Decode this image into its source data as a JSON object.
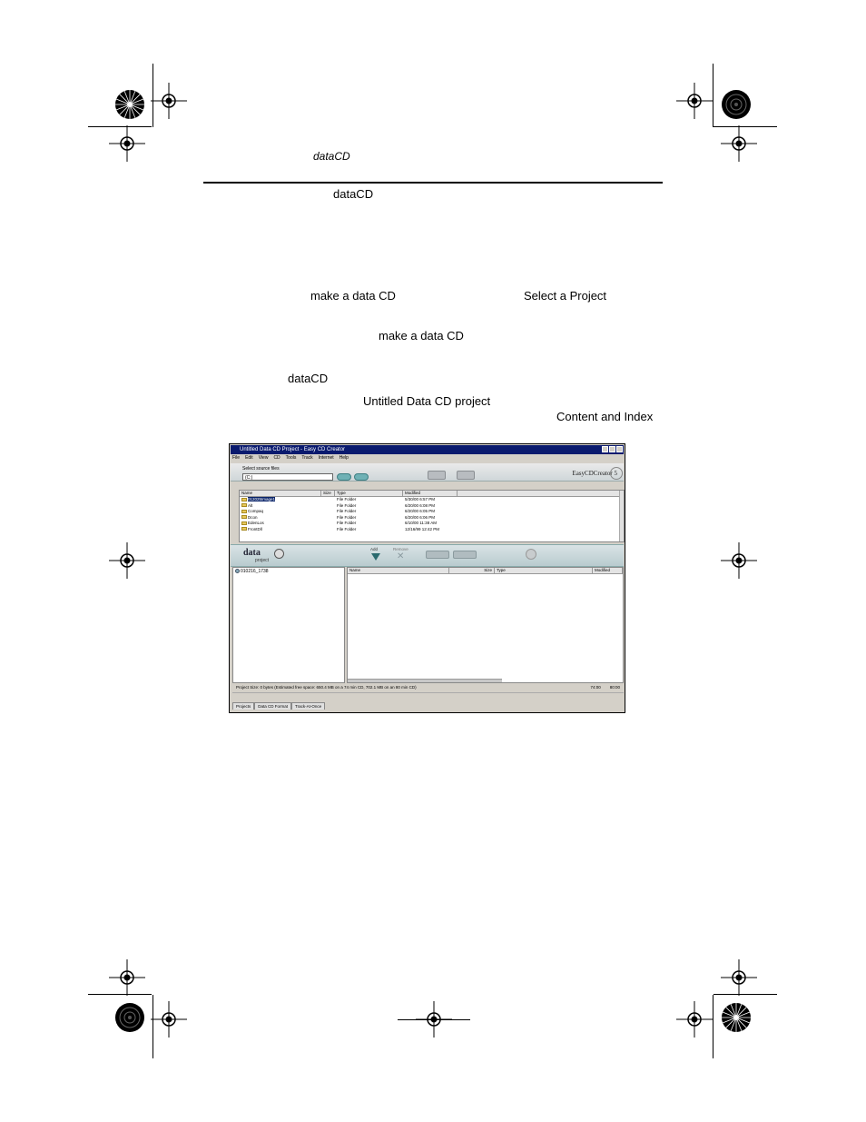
{
  "page": {
    "running_header": "dataCD",
    "body_text": {
      "t1": "dataCD",
      "t2": "make a data CD",
      "t3": "Select a Project",
      "t4": "make a data CD",
      "t5": "dataCD",
      "t6": "Untitled Data CD project",
      "t7": "Content and Index"
    }
  },
  "window": {
    "title": "Untitled Data CD Project - Easy CD Creator",
    "menu": [
      "File",
      "Edit",
      "View",
      "CD",
      "Tools",
      "Track",
      "Internet",
      "Help"
    ],
    "source_label": "Select source files",
    "source_value": "(C:)",
    "brand": "EasyCDCreator 5",
    "file_columns": [
      "Name",
      "Size",
      "Type",
      "Modified"
    ],
    "files": [
      {
        "name": "012025Image1",
        "type": "File Folder",
        "modified": "5/30/00 6:57 PM"
      },
      {
        "name": "Alt",
        "type": "File Folder",
        "modified": "6/20/00 6:08 PM"
      },
      {
        "name": "Compaq",
        "type": "File Folder",
        "modified": "6/20/00 6:05 PM"
      },
      {
        "name": "Dcon",
        "type": "File Folder",
        "modified": "6/20/00 6:06 PM"
      },
      {
        "name": "EdenLos",
        "type": "File Folder",
        "modified": "6/10/00 11:38 AM"
      },
      {
        "name": "FrontDll",
        "type": "File Folder",
        "modified": "12/16/99 12:42 PM"
      }
    ],
    "project_logo": "data",
    "project_sub": "project",
    "add_label": "Add",
    "remove_label": "Remove",
    "tree_item": "010216_1738",
    "content_columns": [
      "Name",
      "Size",
      "Type",
      "Modified"
    ],
    "status_left": "Project Size: 0 bytes  (Estimated free space: 650.4 MB on a 74 min CD, 702.1 MB on an 80 min CD)",
    "status_mid": "74:00",
    "status_right": "80:00",
    "tabs": [
      "Projects",
      "Data CD Format",
      "Track-At-Once"
    ]
  }
}
